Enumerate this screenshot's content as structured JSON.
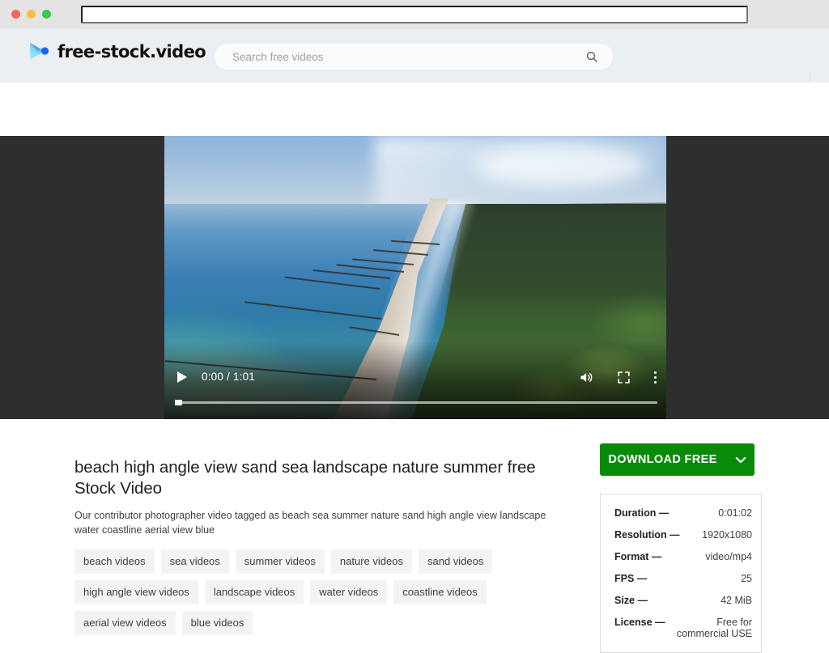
{
  "browser": {
    "url_value": "",
    "url_placeholder": "",
    "traffic_lights": [
      "close",
      "minimize",
      "zoom"
    ]
  },
  "header": {
    "logo_text": "free-stock.video",
    "logo_icon": "play-triangle-logo-icon",
    "search": {
      "value": "",
      "placeholder": "Search free videos",
      "icon": "search-icon"
    }
  },
  "player": {
    "play_icon": "play-icon",
    "time": "0:00 / 1:01",
    "current_time": "0:00",
    "duration_display": "1:01",
    "volume_icon": "volume-on-icon",
    "fullscreen_icon": "fullscreen-icon",
    "more_icon": "kebab-menu-icon",
    "progress_percent": 0
  },
  "main": {
    "title": "beach high angle view sand sea landscape nature summer free Stock Video",
    "description": "Our contributor photographer video tagged as beach sea summer nature sand high angle view landscape water coastline aerial view blue",
    "tags": [
      "beach videos",
      "sea videos",
      "summer videos",
      "nature videos",
      "sand videos",
      "high angle view videos",
      "landscape videos",
      "water videos",
      "coastline videos",
      "aerial view videos",
      "blue videos"
    ]
  },
  "sidebar": {
    "download_label": "DOWNLOAD FREE",
    "download_chevron_icon": "chevron-down-icon",
    "specs": [
      {
        "key": "Duration —",
        "value": "0:01:02"
      },
      {
        "key": "Resolution —",
        "value": "1920x1080"
      },
      {
        "key": "Format —",
        "value": "video/mp4"
      },
      {
        "key": "FPS —",
        "value": "25"
      },
      {
        "key": "Size —",
        "value": "42 MiB"
      }
    ],
    "license": {
      "key": "License —",
      "value": "Free for commercial USE"
    }
  },
  "colors": {
    "download_green": "#0a8a0a",
    "header_bg": "#eceff1",
    "chip_bg": "#f1f3f4",
    "stage_bg": "#2e2e2e"
  }
}
